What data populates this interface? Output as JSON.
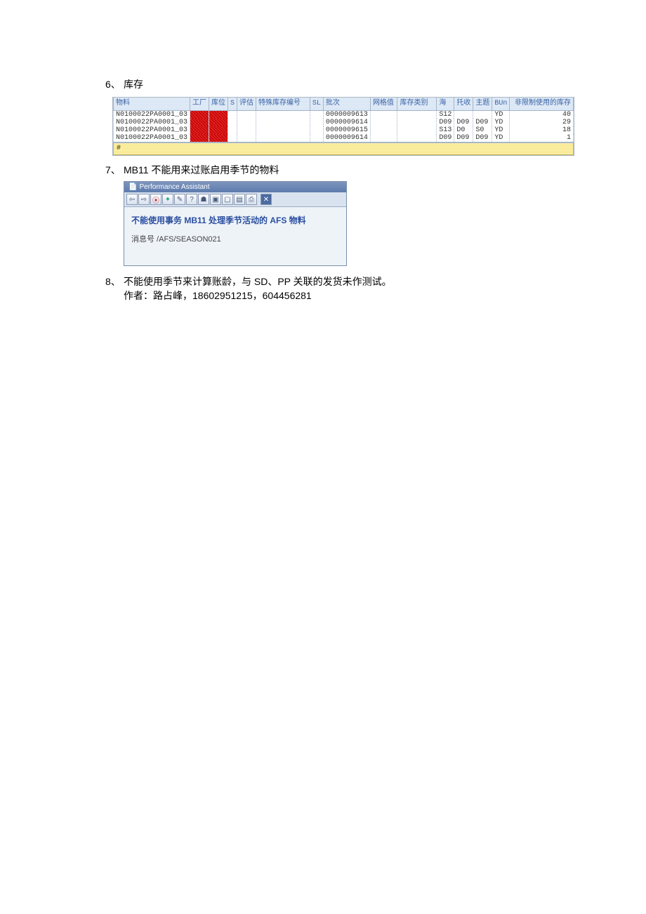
{
  "sections": {
    "s6": {
      "num": "6、",
      "title": "库存"
    },
    "s7": {
      "num": "7、",
      "title": "MB11 不能用来过账启用季节的物料"
    },
    "s8": {
      "num": "8、",
      "line1": "不能使用季节来计算账龄，与 SD、PP 关联的发货未作测试。",
      "line2": "作者：路占峰，18602951215，604456281"
    }
  },
  "table": {
    "headers": [
      "物料",
      "工厂",
      "库位",
      "S",
      "评估",
      "特殊库存编号",
      "SL",
      "批次",
      "网格值",
      "库存类别",
      "海",
      "托收",
      "主题",
      "BUn",
      "非限制使用的库存"
    ],
    "rows": [
      {
        "material": "N0100022PA0001_03",
        "batch": "0000009613",
        "c1": "S12",
        "c2": "",
        "c3": "",
        "bun": "YD",
        "qty": "40"
      },
      {
        "material": "N0100022PA0001_03",
        "batch": "0000009614",
        "c1": "D09",
        "c2": "D09",
        "c3": "D09",
        "bun": "YD",
        "qty": "29"
      },
      {
        "material": "N0100022PA0001_03",
        "batch": "0000009615",
        "c1": "S13",
        "c2": "D0",
        "c3": "S0",
        "bun": "YD",
        "qty": "18"
      },
      {
        "material": "N0100022PA0001_03",
        "batch": "0000009614",
        "c1": "D09",
        "c2": "D09",
        "c3": "D09",
        "bun": "YD",
        "qty": "1"
      }
    ]
  },
  "dialog": {
    "title": "Performance Assistant",
    "message": "不能使用事务  MB11  处理季节活动的  AFS 物料",
    "sub": "消息号 /AFS/SEASON021",
    "icons": [
      "back",
      "forward",
      "stop",
      "refresh",
      "edit",
      "help",
      "tree",
      "view",
      "window",
      "page",
      "print",
      "close"
    ]
  }
}
